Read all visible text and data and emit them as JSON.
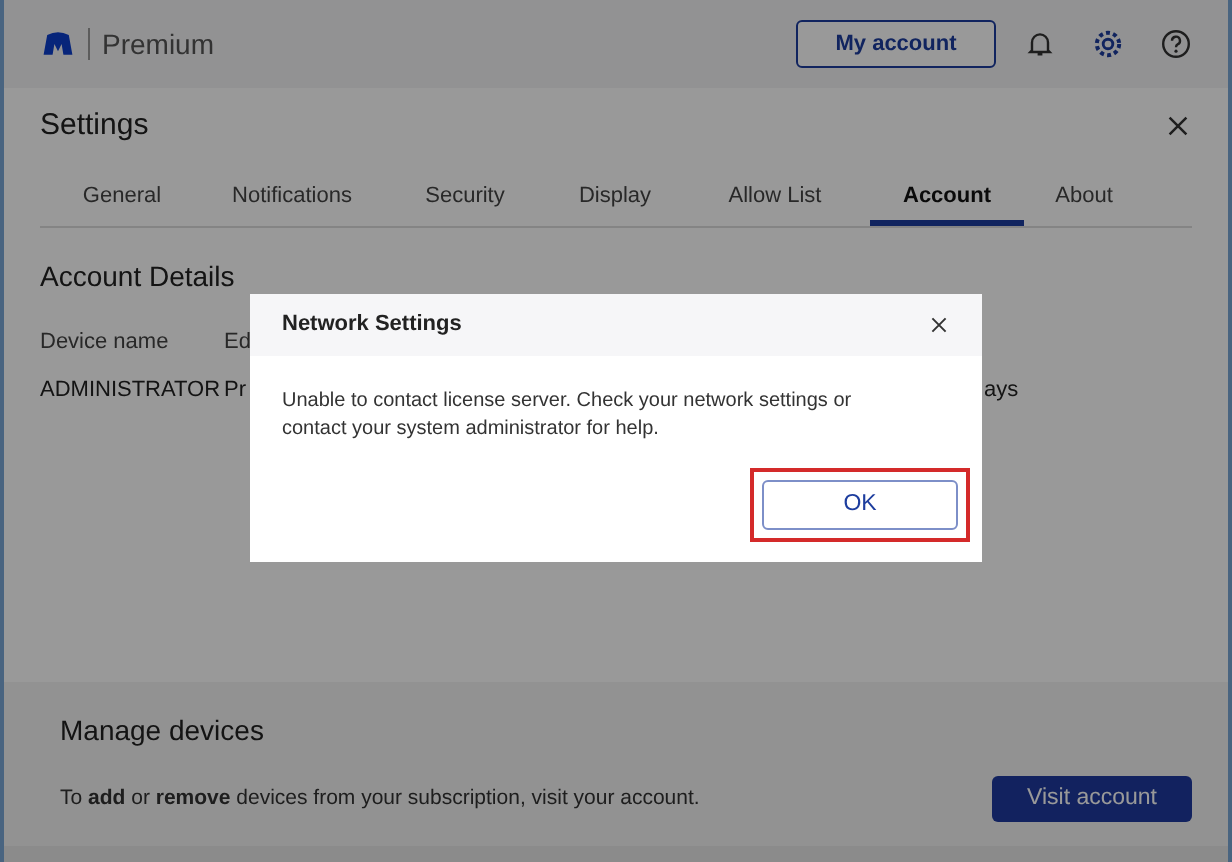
{
  "header": {
    "product": "Premium",
    "account_button": "My account"
  },
  "settings": {
    "title": "Settings",
    "tabs": [
      {
        "label": "General",
        "selected": false
      },
      {
        "label": "Notifications",
        "selected": false
      },
      {
        "label": "Security",
        "selected": false
      },
      {
        "label": "Display",
        "selected": false
      },
      {
        "label": "Allow List",
        "selected": false
      },
      {
        "label": "Account",
        "selected": true
      },
      {
        "label": "About",
        "selected": false
      }
    ],
    "account_details": {
      "heading": "Account Details",
      "column_1_label": "Device name",
      "column_1_value": "ADMINISTRATOR",
      "column_2_label": "Ed",
      "column_2_value": "Pr",
      "column_3_value": "ays"
    },
    "manage_devices": {
      "heading": "Manage devices",
      "text": "To **add** or **remove** devices from your subscription, visit your account.",
      "button": "Visit account"
    }
  },
  "dialog": {
    "title": "Network Settings",
    "message": "Unable to contact license server. Check your network settings or contact your system administrator for help.",
    "ok_button": {
      "label": "OK",
      "highlighted": true
    }
  }
}
